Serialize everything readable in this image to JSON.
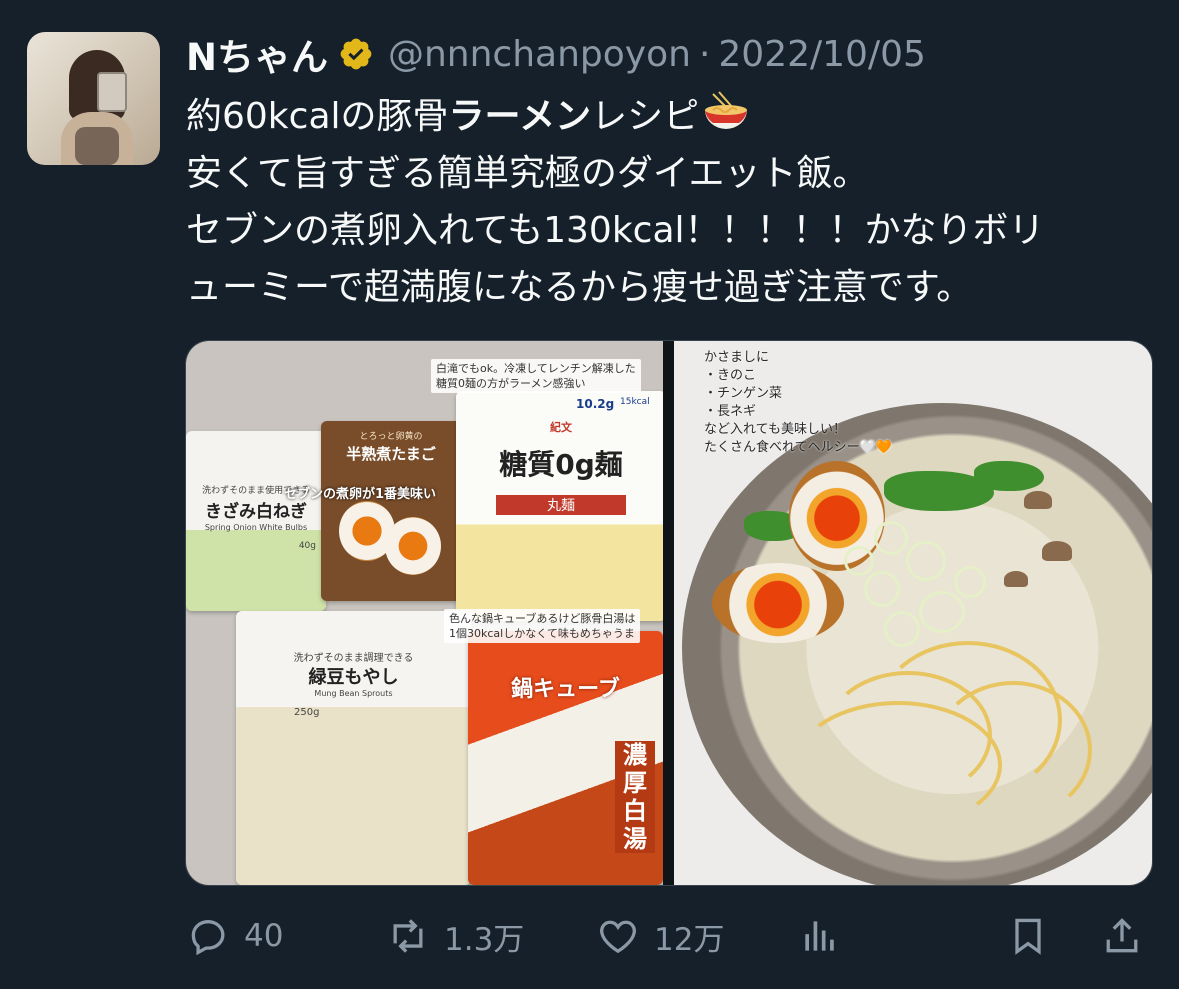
{
  "tweet": {
    "author_name": "Nちゃん",
    "handle": "@nnnchanpoyon",
    "separator": "·",
    "date": "2022/10/05",
    "text_line1_a": "約60kcalの豚骨",
    "text_line1_b": "ラーメン",
    "text_line1_c": "レシピ",
    "text_line2": "安くて旨すぎる簡単究極のダイエット飯。",
    "text_line3": "セブンの煮卵入れても130kcal！！！！！かなりボリ",
    "text_line4": "ューミーで超満腹になるから痩せ過ぎ注意です。"
  },
  "media": {
    "left": {
      "note_top_1": "白滝でもok。冷凍してレンチン解凍した",
      "note_top_2": "糖質0麺の方がラーメン感強い",
      "note_egg": "セブンの煮卵が1番美味い",
      "note_cube_1": "色んな鍋キューブあるけど豚骨白湯は",
      "note_cube_2": "1個30kcalしかなくて味もめちゃうま",
      "onion_label": "きざみ白ねぎ",
      "onion_top": "洗わずそのまま使用できる",
      "onion_en": "Spring Onion White Bulbs",
      "onion_weight": "40g",
      "egg_top": "とろっと卵黄の",
      "egg_label": "半熟煮たまご",
      "noodle_brand": "紀文",
      "noodle_label": "糖質0g麺",
      "noodle_sub": "丸麺",
      "noodle_carb": "10.2g",
      "noodle_kcal": "15kcal",
      "sprout_top": "洗わずそのまま調理できる",
      "sprout_label": "緑豆もやし",
      "sprout_en": "Mung Bean Sprouts",
      "sprout_weight": "250g",
      "cube_label": "鍋キューブ",
      "cube_sub": "濃厚白湯"
    },
    "right": {
      "note_lines": [
        "かさましに",
        "・きのこ",
        "・チンゲン菜",
        "・長ネギ",
        "など入れても美味しい！",
        "たくさん食べれてヘルシー🤍🧡"
      ]
    }
  },
  "actions": {
    "reply_count": "40",
    "retweet_count": "1.3万",
    "like_count": "12万"
  },
  "colors": {
    "background": "#15202b",
    "text": "#f7f9f9",
    "secondary": "#8b98a5",
    "verified_badge": "#e2b719"
  }
}
